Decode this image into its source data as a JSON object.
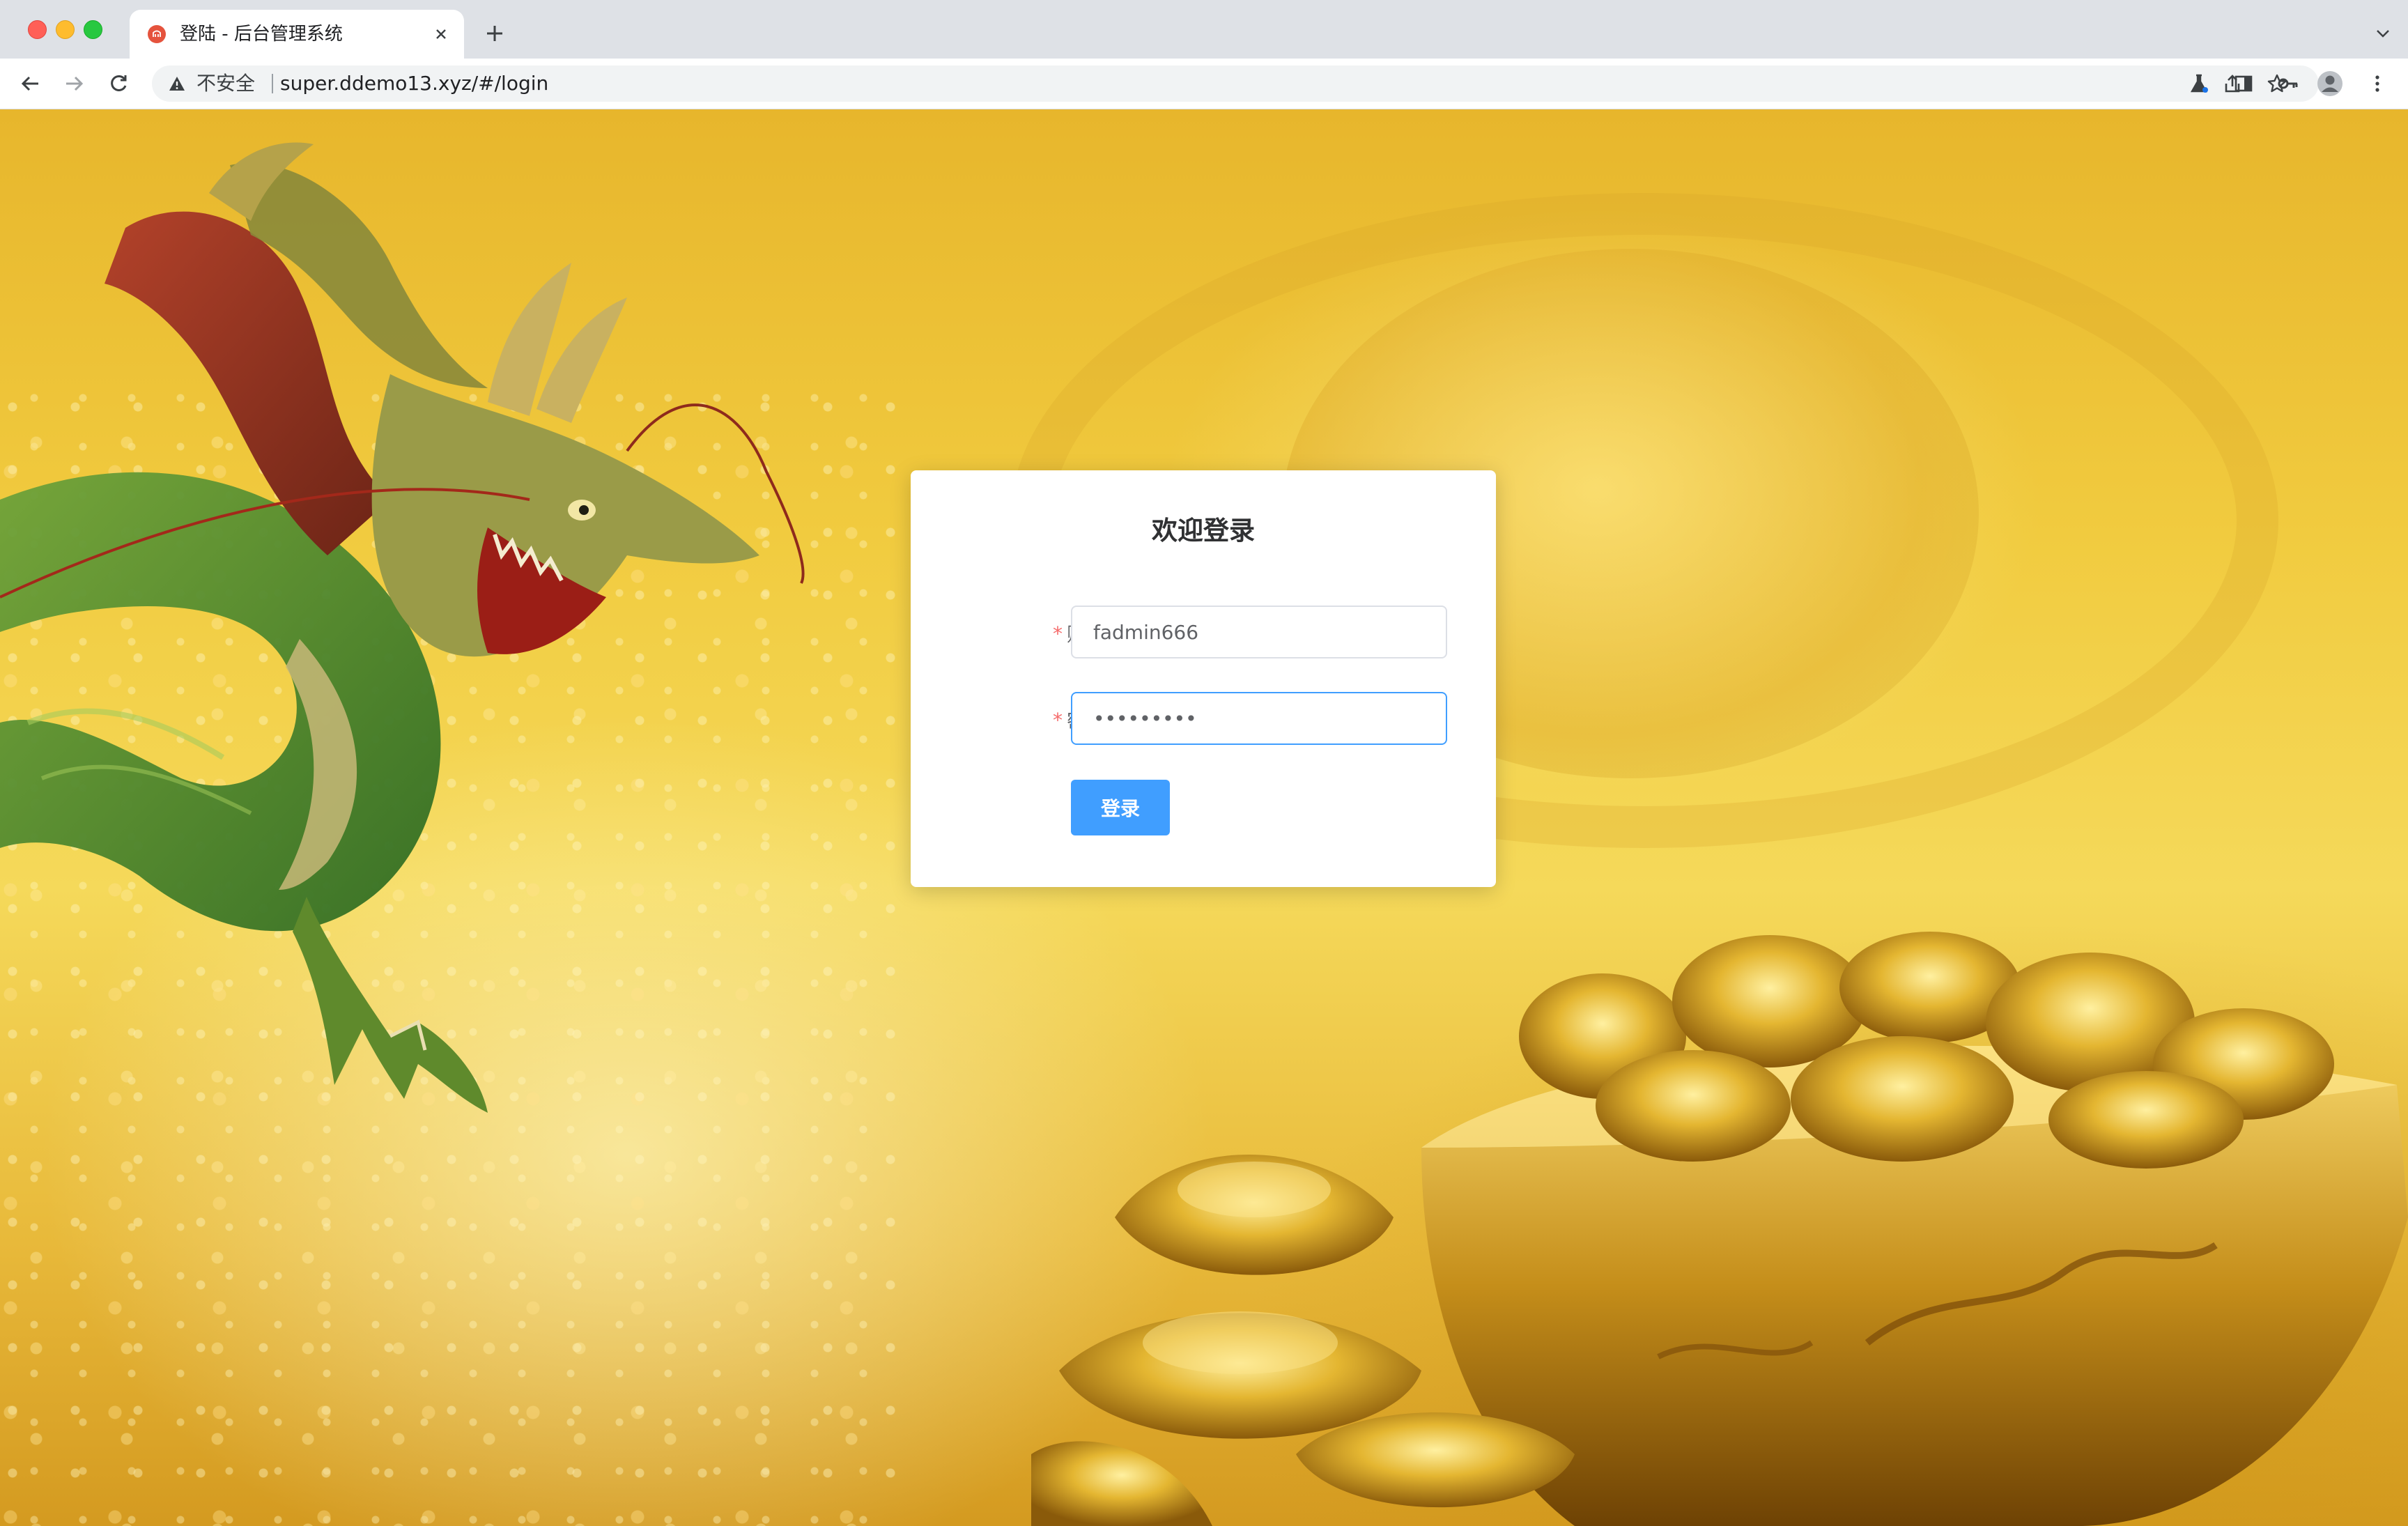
{
  "browser": {
    "tab_title": "登陆 - 后台管理系统",
    "address_security": "不安全",
    "url": "super.ddemo13.xyz/#/login"
  },
  "login": {
    "title": "欢迎登录",
    "account": {
      "required_mark": "*",
      "label": "账号",
      "value": "fadmin666"
    },
    "password": {
      "required_mark": "*",
      "label": "密码",
      "value": "•••••••••"
    },
    "submit_label": "登录"
  },
  "colors": {
    "primary": "#409eff",
    "required": "#f56c6c"
  }
}
